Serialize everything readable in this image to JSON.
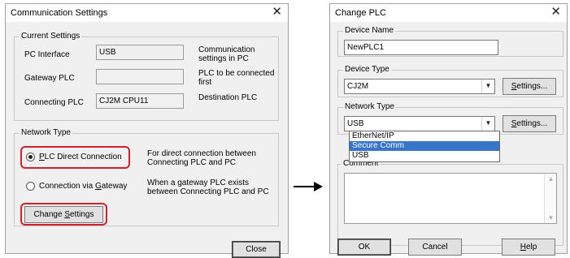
{
  "comm": {
    "title": "Communication Settings",
    "current_settings": {
      "label": "Current Settings",
      "pc_interface_label": "PC Interface",
      "pc_interface_value": "USB",
      "pc_interface_desc": "Communication settings in PC",
      "gateway_label": "Gateway PLC",
      "gateway_value": "",
      "gateway_desc": "PLC to be connected first",
      "connecting_label": "Connecting PLC",
      "connecting_value": "CJ2M CPU11",
      "connecting_desc": "Destination PLC"
    },
    "network_type": {
      "label": "Network Type",
      "direct_label": "PLC Direct Connection",
      "direct_desc": "For direct connection between Connecting PLC and PC",
      "gateway_conn_label": "Connection via Gateway",
      "gateway_conn_desc": "When a gateway PLC exists between Connecting PLC and PC",
      "selected": "direct"
    },
    "change_settings_label": "Change Settings",
    "close_label": "Close"
  },
  "change": {
    "title": "Change PLC",
    "device_name_label": "Device Name",
    "device_name_value": "NewPLC1",
    "device_type_label": "Device Type",
    "device_type_value": "CJ2M",
    "settings_label": "Settings...",
    "network_type_label": "Network Type",
    "network_type_value": "USB",
    "network_options": [
      "EtherNet/IP",
      "Secure Comm",
      "USB"
    ],
    "network_highlighted": "Secure Comm",
    "comment_label": "Comment",
    "comment_value": "",
    "ok_label": "OK",
    "cancel_label": "Cancel",
    "help_label": "Help"
  },
  "colors": {
    "highlight": "#d0202a",
    "selection": "#3875c8"
  }
}
